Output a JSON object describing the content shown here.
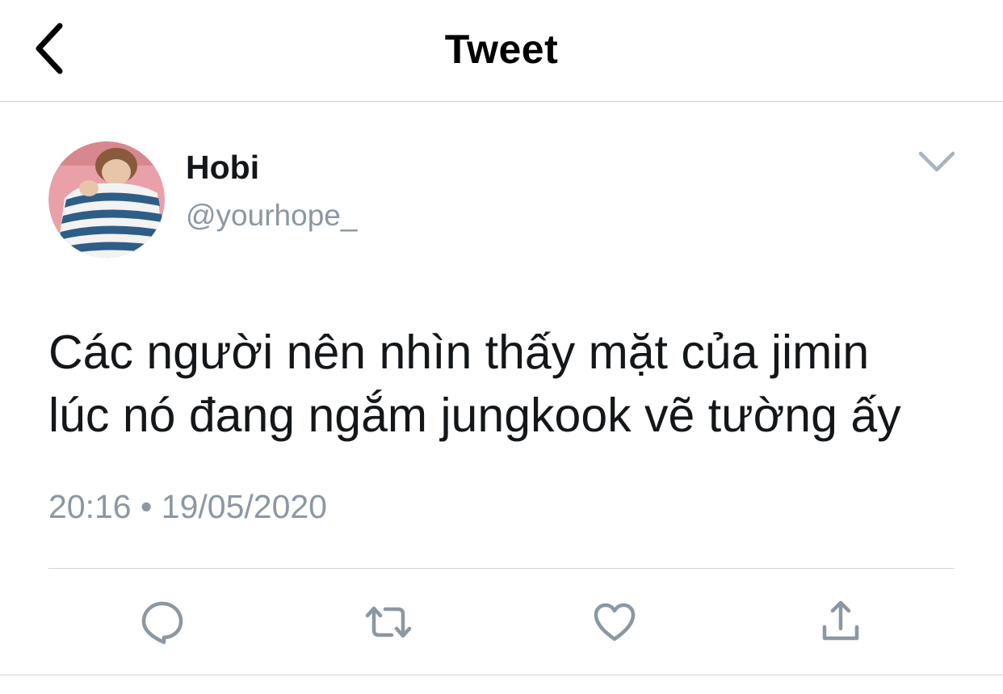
{
  "header": {
    "title": "Tweet",
    "back_icon": "chevron-left-icon"
  },
  "tweet": {
    "author": {
      "name": "Hobi",
      "handle": "@yourhope_"
    },
    "text_lines": [
      "Các người nên nhìn thấy mặt của jimin",
      "lúc nó đang ngắm jungkook vẽ tường ấy"
    ],
    "time": "20:16",
    "separator": "•",
    "date": "19/05/2020",
    "menu_icon": "chevron-down-icon"
  },
  "actions": [
    {
      "icon": "reply-icon"
    },
    {
      "icon": "retweet-icon"
    },
    {
      "icon": "like-heart-icon"
    },
    {
      "icon": "share-icon"
    }
  ],
  "colors": {
    "text": "#14171a",
    "secondary": "#8b97a2",
    "divider": "#cfd4d8",
    "icon": "#8b97a2"
  }
}
